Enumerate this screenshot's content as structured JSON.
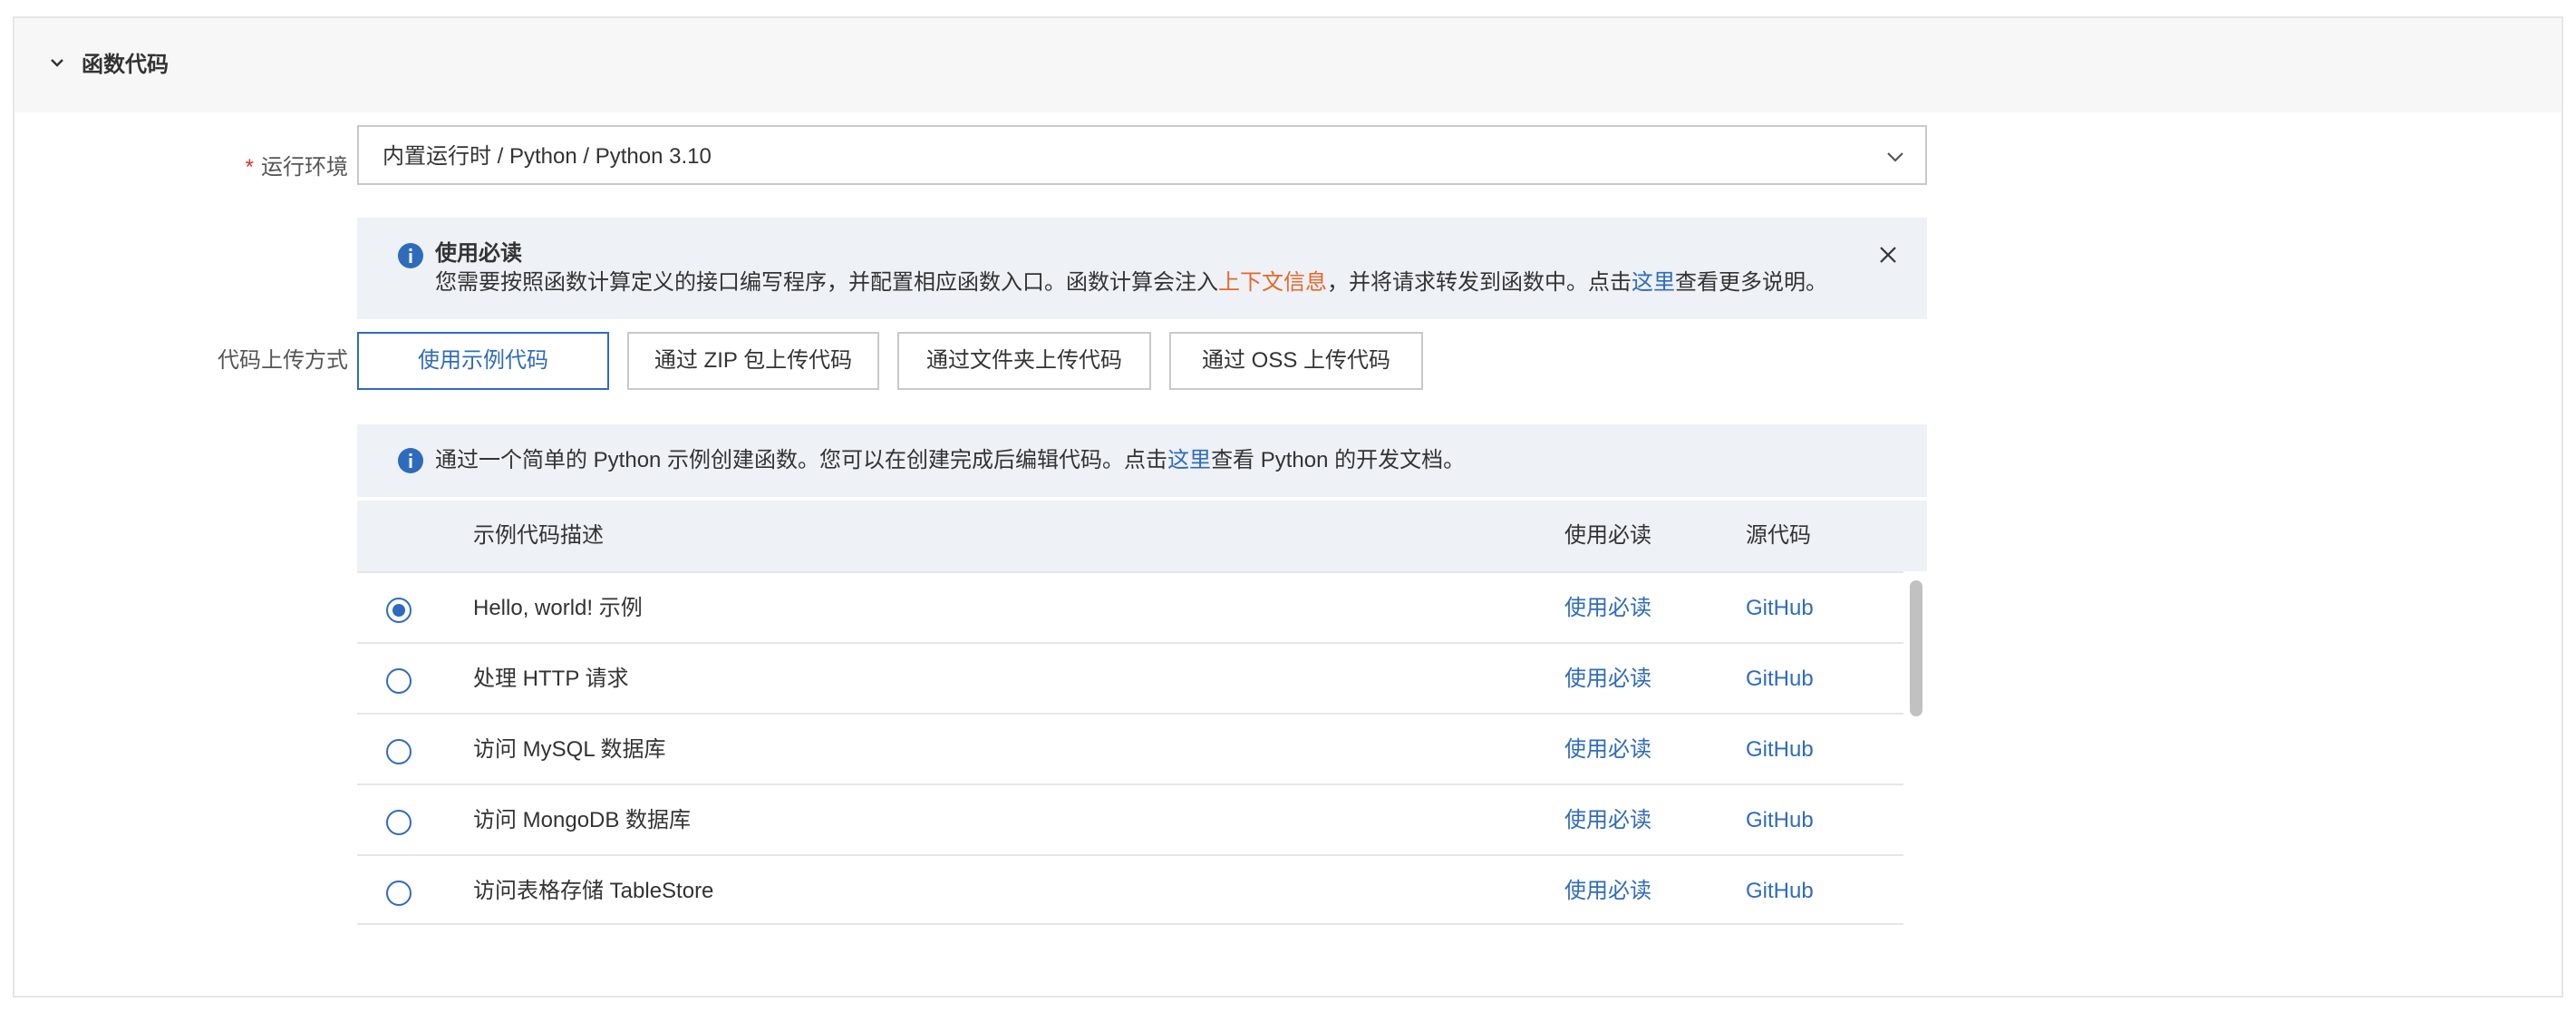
{
  "section": {
    "title": "函数代码"
  },
  "runtime": {
    "label": "运行环境",
    "required_mark": "*",
    "value": "内置运行时 / Python /  Python 3.10"
  },
  "notice": {
    "title": "使用必读",
    "text_before": "您需要按照函数计算定义的接口编写程序，并配置相应函数入口。函数计算会注入",
    "link_context": "上下文信息",
    "text_middle": "，并将请求转发到函数中。点击",
    "link_here": "这里",
    "text_after": "查看更多说明。"
  },
  "upload": {
    "label": "代码上传方式",
    "options": [
      {
        "label": "使用示例代码",
        "active": true
      },
      {
        "label": "通过 ZIP 包上传代码",
        "active": false
      },
      {
        "label": "通过文件夹上传代码",
        "active": false
      },
      {
        "label": "通过 OSS 上传代码",
        "active": false
      }
    ]
  },
  "hint": {
    "text_before": "通过一个简单的 Python 示例创建函数。您可以在创建完成后编辑代码。点击",
    "link_here": "这里",
    "text_after": "查看 Python 的开发文档。"
  },
  "table": {
    "headers": {
      "description": "示例代码描述",
      "readme": "使用必读",
      "source": "源代码"
    },
    "rows": [
      {
        "description": "Hello, world! 示例",
        "readme": "使用必读",
        "source": "GitHub",
        "selected": true
      },
      {
        "description": "处理 HTTP 请求",
        "readme": "使用必读",
        "source": "GitHub",
        "selected": false
      },
      {
        "description": "访问 MySQL 数据库",
        "readme": "使用必读",
        "source": "GitHub",
        "selected": false
      },
      {
        "description": "访问 MongoDB 数据库",
        "readme": "使用必读",
        "source": "GitHub",
        "selected": false
      },
      {
        "description": "访问表格存储 TableStore",
        "readme": "使用必读",
        "source": "GitHub",
        "selected": false
      }
    ]
  },
  "colors": {
    "accent": "#2f6bbd",
    "highlight": "#e8672a",
    "required": "#d93026",
    "notice_bg": "#eef1f5"
  },
  "icons": {
    "collapse": "chevron-down-icon",
    "select_arrow": "chevron-down-icon",
    "info": "info-icon",
    "close": "close-icon"
  }
}
